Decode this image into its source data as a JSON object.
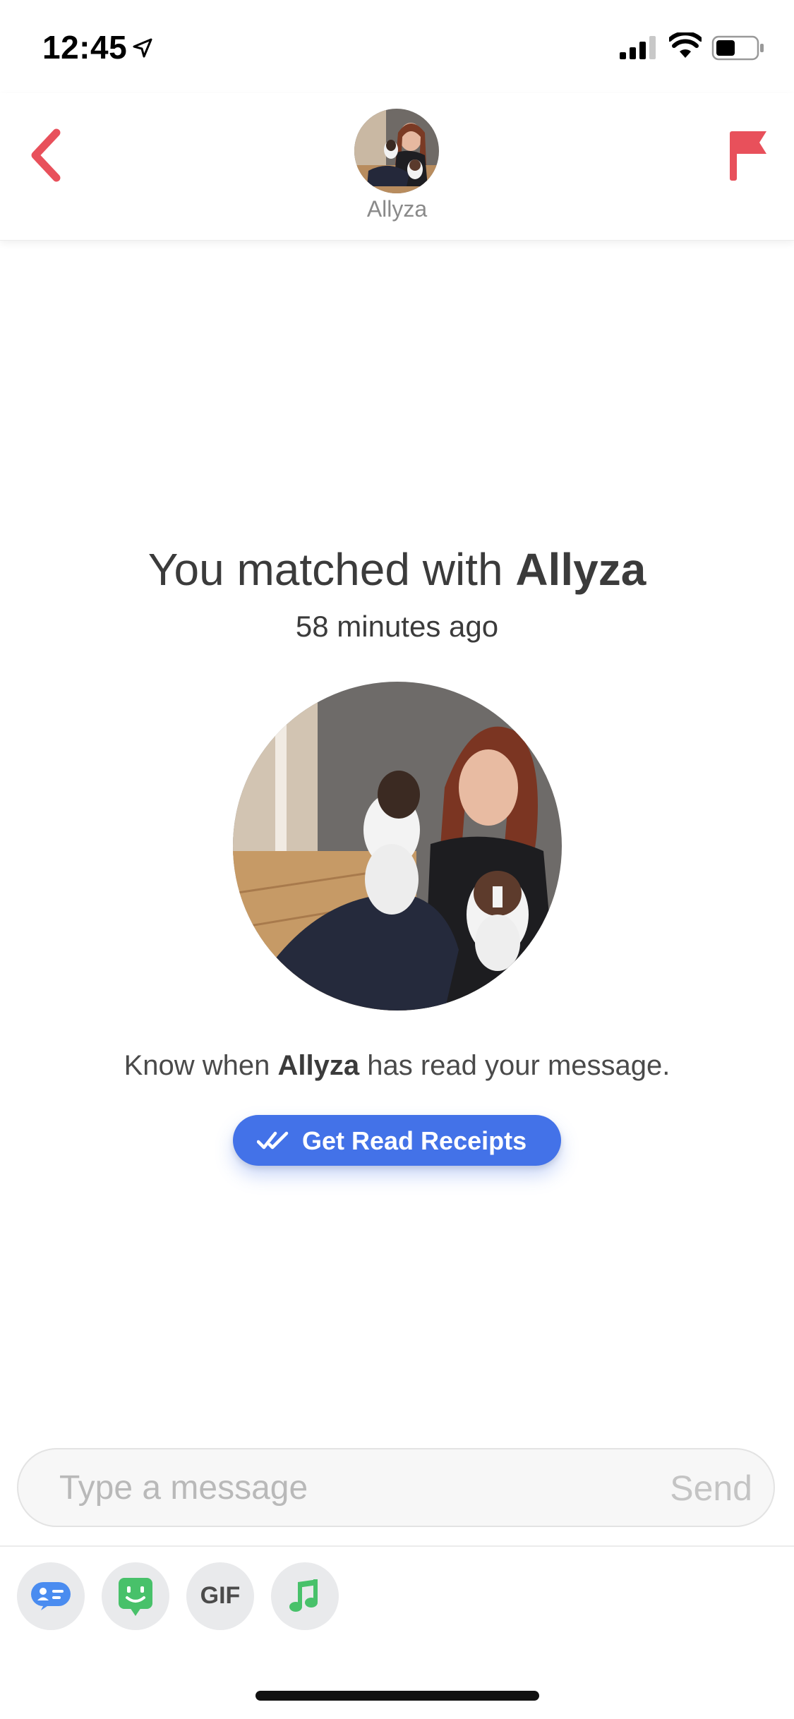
{
  "status_bar": {
    "time": "12:45"
  },
  "header": {
    "name": "Allyza"
  },
  "match": {
    "title_prefix": "You matched with ",
    "name": "Allyza",
    "time_ago": "58 minutes ago",
    "receipt_prefix": "Know when ",
    "receipt_suffix": " has read your message.",
    "receipts_button_label": "Get Read Receipts"
  },
  "composer": {
    "placeholder": "Type a message",
    "send_label": "Send"
  },
  "toolbar": {
    "gif_label": "GIF"
  },
  "colors": {
    "accent_red": "#e8505b",
    "button_blue": "#4372e8",
    "sticker_green": "#48c16a"
  },
  "icons": [
    "location-arrow-icon",
    "signal-icon",
    "wifi-icon",
    "battery-icon",
    "back-chevron-icon",
    "flag-icon",
    "double-check-icon",
    "profile-card-icon",
    "sticker-icon",
    "music-note-icon"
  ]
}
